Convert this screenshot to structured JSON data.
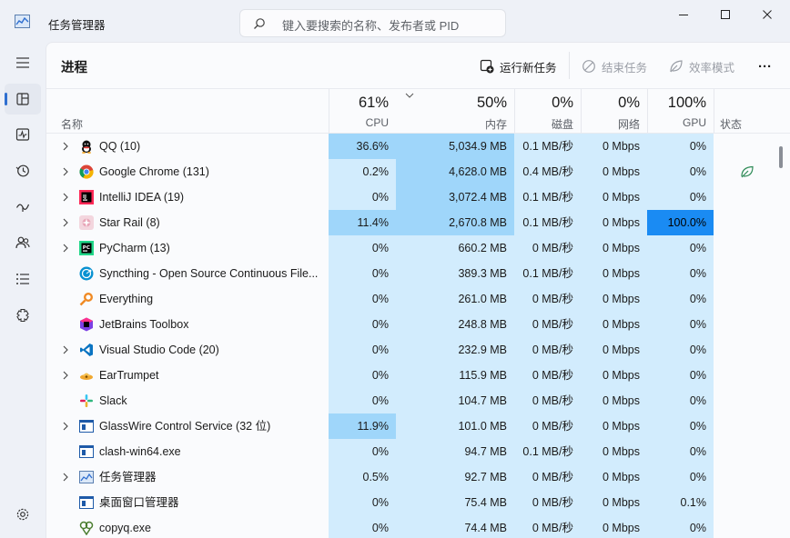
{
  "window": {
    "title": "任务管理器",
    "search_placeholder": "键入要搜索的名称、发布者或 PID"
  },
  "sidebar": {
    "items": [
      {
        "name": "hamburger-menu-icon"
      },
      {
        "name": "processes-icon",
        "active": true
      },
      {
        "name": "performance-icon"
      },
      {
        "name": "app-history-icon"
      },
      {
        "name": "startup-apps-icon"
      },
      {
        "name": "users-icon"
      },
      {
        "name": "details-icon"
      },
      {
        "name": "services-icon"
      }
    ],
    "settings": "settings-icon"
  },
  "page": {
    "title": "进程",
    "run_new_task": "运行新任务",
    "end_task": "结束任务",
    "efficiency_mode": "效率模式",
    "more": "···"
  },
  "columns": {
    "name": "名称",
    "cpu": {
      "pct": "61%",
      "label": "CPU"
    },
    "memory": {
      "pct": "50%",
      "label": "内存"
    },
    "disk": {
      "pct": "0%",
      "label": "磁盘"
    },
    "network": {
      "pct": "0%",
      "label": "网络"
    },
    "gpu": {
      "pct": "100%",
      "label": "GPU"
    },
    "status": "状态"
  },
  "colors": {
    "heat_light": "#d2ecfd",
    "heat_mid": "#c4e6fc",
    "heat_strong": "#9fd6fa",
    "gpu_full": "#1a8bf3",
    "accent": "#2f6fd0"
  },
  "processes": [
    {
      "name": "QQ (10)",
      "expand": true,
      "icon": "qq-icon",
      "cpu": "36.6%",
      "mem": "5,034.9 MB",
      "disk": "0.1 MB/秒",
      "net": "0 Mbps",
      "gpu": "0%",
      "cpu_level": "strong",
      "mem_level": "strong",
      "gpu_level": "light"
    },
    {
      "name": "Google Chrome (131)",
      "expand": true,
      "icon": "chrome-icon",
      "cpu": "0.2%",
      "mem": "4,628.0 MB",
      "disk": "0.4 MB/秒",
      "net": "0 Mbps",
      "gpu": "0%",
      "cpu_level": "light",
      "mem_level": "strong",
      "gpu_level": "light",
      "status_icon": true
    },
    {
      "name": "IntelliJ IDEA (19)",
      "expand": true,
      "icon": "intellij-icon",
      "cpu": "0%",
      "mem": "3,072.4 MB",
      "disk": "0.1 MB/秒",
      "net": "0 Mbps",
      "gpu": "0%",
      "cpu_level": "light",
      "mem_level": "strong",
      "gpu_level": "light"
    },
    {
      "name": "Star Rail (8)",
      "expand": true,
      "icon": "star-rail-icon",
      "cpu": "11.4%",
      "mem": "2,670.8 MB",
      "disk": "0.1 MB/秒",
      "net": "0 Mbps",
      "gpu": "100.0%",
      "cpu_level": "strong",
      "mem_level": "strong",
      "gpu_level": "full"
    },
    {
      "name": "PyCharm (13)",
      "expand": true,
      "icon": "pycharm-icon",
      "cpu": "0%",
      "mem": "660.2 MB",
      "disk": "0 MB/秒",
      "net": "0 Mbps",
      "gpu": "0%",
      "cpu_level": "light",
      "mem_level": "light",
      "gpu_level": "light"
    },
    {
      "name": "Syncthing - Open Source Continuous File...",
      "expand": false,
      "icon": "syncthing-icon",
      "cpu": "0%",
      "mem": "389.3 MB",
      "disk": "0.1 MB/秒",
      "net": "0 Mbps",
      "gpu": "0%",
      "cpu_level": "light",
      "mem_level": "light",
      "gpu_level": "light"
    },
    {
      "name": "Everything",
      "expand": false,
      "icon": "everything-icon",
      "cpu": "0%",
      "mem": "261.0 MB",
      "disk": "0 MB/秒",
      "net": "0 Mbps",
      "gpu": "0%",
      "cpu_level": "light",
      "mem_level": "light",
      "gpu_level": "light"
    },
    {
      "name": "JetBrains Toolbox",
      "expand": false,
      "icon": "jetbrains-toolbox-icon",
      "cpu": "0%",
      "mem": "248.8 MB",
      "disk": "0 MB/秒",
      "net": "0 Mbps",
      "gpu": "0%",
      "cpu_level": "light",
      "mem_level": "light",
      "gpu_level": "light"
    },
    {
      "name": "Visual Studio Code (20)",
      "expand": true,
      "icon": "vscode-icon",
      "cpu": "0%",
      "mem": "232.9 MB",
      "disk": "0 MB/秒",
      "net": "0 Mbps",
      "gpu": "0%",
      "cpu_level": "light",
      "mem_level": "light",
      "gpu_level": "light"
    },
    {
      "name": "EarTrumpet",
      "expand": true,
      "icon": "eartrumpet-icon",
      "cpu": "0%",
      "mem": "115.9 MB",
      "disk": "0 MB/秒",
      "net": "0 Mbps",
      "gpu": "0%",
      "cpu_level": "light",
      "mem_level": "light",
      "gpu_level": "light"
    },
    {
      "name": "Slack",
      "expand": false,
      "icon": "slack-icon",
      "cpu": "0%",
      "mem": "104.7 MB",
      "disk": "0 MB/秒",
      "net": "0 Mbps",
      "gpu": "0%",
      "cpu_level": "light",
      "mem_level": "light",
      "gpu_level": "light"
    },
    {
      "name": "GlassWire Control Service (32 位)",
      "expand": true,
      "icon": "glasswire-icon",
      "cpu": "11.9%",
      "mem": "101.0 MB",
      "disk": "0 MB/秒",
      "net": "0 Mbps",
      "gpu": "0%",
      "cpu_level": "strong",
      "mem_level": "light",
      "gpu_level": "light"
    },
    {
      "name": "clash-win64.exe",
      "expand": false,
      "icon": "clash-icon",
      "cpu": "0%",
      "mem": "94.7 MB",
      "disk": "0.1 MB/秒",
      "net": "0 Mbps",
      "gpu": "0%",
      "cpu_level": "light",
      "mem_level": "light",
      "gpu_level": "light"
    },
    {
      "name": "任务管理器",
      "expand": true,
      "icon": "task-manager-icon",
      "cpu": "0.5%",
      "mem": "92.7 MB",
      "disk": "0 MB/秒",
      "net": "0 Mbps",
      "gpu": "0%",
      "cpu_level": "light",
      "mem_level": "light",
      "gpu_level": "light"
    },
    {
      "name": "桌面窗口管理器",
      "expand": false,
      "icon": "dwm-icon",
      "cpu": "0%",
      "mem": "75.4 MB",
      "disk": "0 MB/秒",
      "net": "0 Mbps",
      "gpu": "0.1%",
      "cpu_level": "light",
      "mem_level": "light",
      "gpu_level": "light"
    },
    {
      "name": "copyq.exe",
      "expand": false,
      "icon": "copyq-icon",
      "cpu": "0%",
      "mem": "74.4 MB",
      "disk": "0 MB/秒",
      "net": "0 Mbps",
      "gpu": "0%",
      "cpu_level": "light",
      "mem_level": "light",
      "gpu_level": "light"
    }
  ]
}
